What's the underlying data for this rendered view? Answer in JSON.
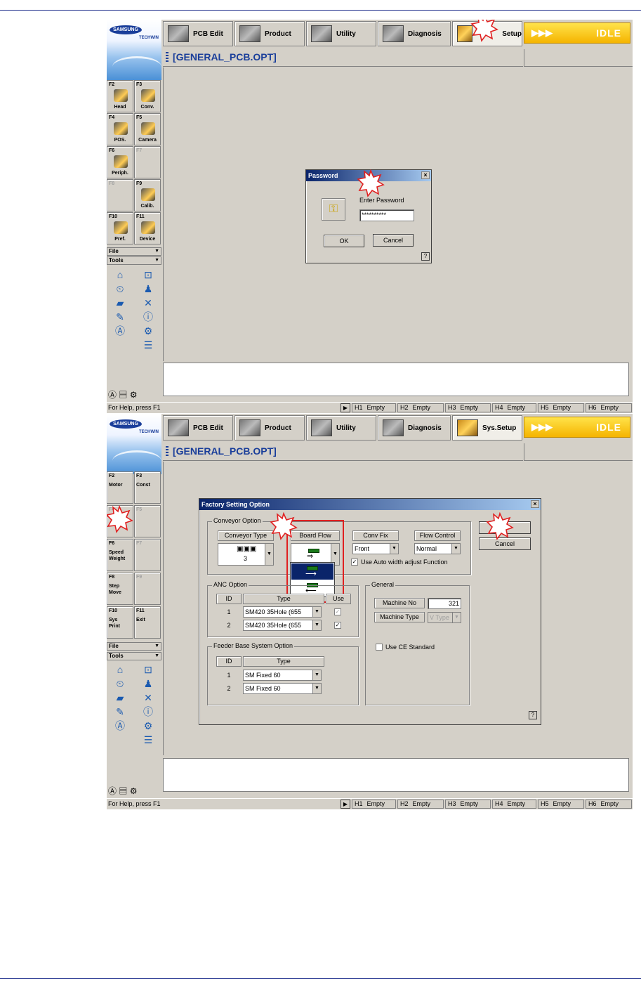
{
  "toolbar": {
    "logo_brand": "SAMSUNG",
    "logo_sub": "TECHWIN",
    "pcb_edit": "PCB Edit",
    "product": "Product",
    "utility": "Utility",
    "diagnosis": "Diagnosis",
    "sys_setup_s1": "Setup",
    "sys_setup_s2": "Sys.Setup",
    "idle_arrows": "▶▶▶",
    "idle_label": "IDLE"
  },
  "file_title": "[GENERAL_PCB.OPT]",
  "screen1": {
    "fkeys": [
      {
        "key": "F2",
        "label": "Head"
      },
      {
        "key": "F3",
        "label": "Conv."
      },
      {
        "key": "F4",
        "label": "POS."
      },
      {
        "key": "F5",
        "label": "Camera"
      },
      {
        "key": "F6",
        "label": "Periph."
      },
      {
        "key": "F7",
        "label": ""
      },
      {
        "key": "F8",
        "label": ""
      },
      {
        "key": "F9",
        "label": "Calib."
      },
      {
        "key": "F10",
        "label": "Pref."
      },
      {
        "key": "F11",
        "label": "Device"
      }
    ],
    "password_dialog": {
      "title": "Password",
      "close": "×",
      "prompt": "Enter Password",
      "value": "**********",
      "ok": "OK",
      "cancel": "Cancel",
      "help": "?"
    }
  },
  "screen2": {
    "fkeys": [
      {
        "key": "F2",
        "label": "Motor"
      },
      {
        "key": "F3",
        "label": "Const"
      },
      {
        "key": "F4",
        "label": ""
      },
      {
        "key": "F5",
        "label": ""
      },
      {
        "key": "F6",
        "label": "Speed\nWeight"
      },
      {
        "key": "F7",
        "label": ""
      },
      {
        "key": "F8",
        "label": "Step\nMove"
      },
      {
        "key": "F9",
        "label": ""
      },
      {
        "key": "F10",
        "label": "Sys\nPrint"
      },
      {
        "key": "F11",
        "label": "Exit"
      }
    ],
    "factory_dialog": {
      "title": "Factory Setting Option",
      "close": "×",
      "conveyor_option": "Conveyor Option",
      "conveyor_type": "Conveyor Type",
      "conveyor_type_value": "3",
      "board_flow": "Board Flow",
      "conv_fix": "Conv Fix",
      "conv_fix_value": "Front",
      "flow_control": "Flow Control",
      "flow_control_value": "Normal",
      "auto_width": "Use Auto width adjust Function",
      "ok": "",
      "cancel": "Cancel",
      "anc_option": "ANC Option",
      "anc_headers": {
        "id": "ID",
        "type": "Type",
        "use": "Use"
      },
      "anc_rows": [
        {
          "id": "1",
          "type": "SM420 35Hole (655"
        },
        {
          "id": "2",
          "type": "SM420 35Hole (655"
        }
      ],
      "general": "General",
      "machine_no_label": "Machine No",
      "machine_no": "321",
      "machine_type_label": "Machine Type",
      "machine_type": "V Type",
      "ce_standard": "Use CE Standard",
      "feeder_option": "Feeder Base System Option",
      "feeder_headers": {
        "id": "ID",
        "type": "Type"
      },
      "feeder_rows": [
        {
          "id": "1",
          "type": "SM Fixed 60"
        },
        {
          "id": "2",
          "type": "SM Fixed 60"
        }
      ],
      "help": "?"
    }
  },
  "side_menu": {
    "file": "File",
    "tools": "Tools"
  },
  "status": {
    "help": "For Help, press F1",
    "play": "▶",
    "slots": [
      {
        "h": "H1",
        "v": "Empty"
      },
      {
        "h": "H2",
        "v": "Empty"
      },
      {
        "h": "H3",
        "v": "Empty"
      },
      {
        "h": "H4",
        "v": "Empty"
      },
      {
        "h": "H5",
        "v": "Empty"
      },
      {
        "h": "H6",
        "v": "Empty"
      }
    ]
  },
  "colors": {
    "accent": "#1a3e9a",
    "idle": "#f5b400",
    "highlight": "#e02020",
    "dialog_title": "#0a246a"
  }
}
